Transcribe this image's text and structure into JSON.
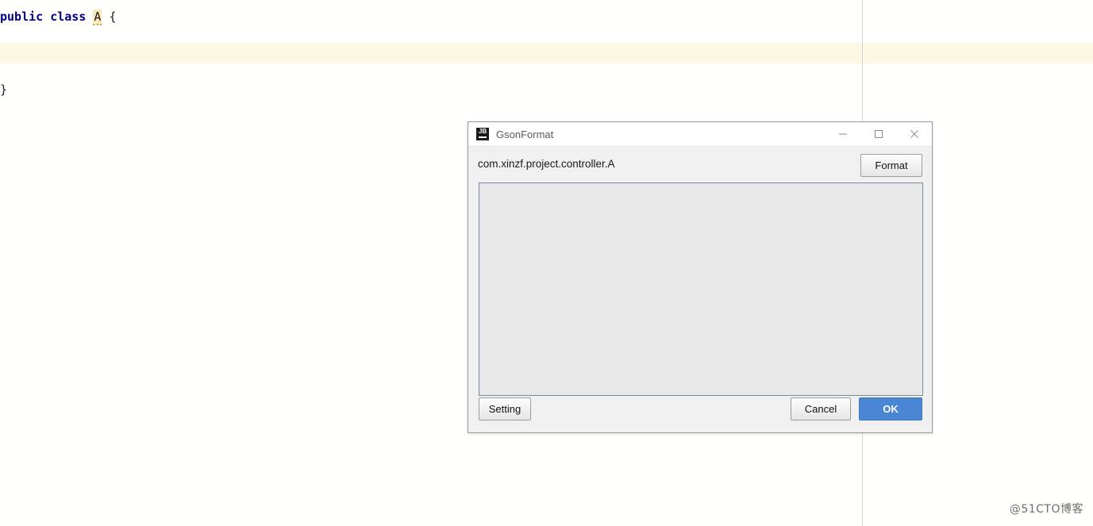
{
  "editor": {
    "lines": [
      {
        "id": "line1",
        "tokens": [
          {
            "text": "public class ",
            "type": "keyword"
          },
          {
            "text": "A",
            "type": "class-name"
          },
          {
            "text": " {",
            "type": "plain"
          }
        ]
      },
      {
        "id": "line3",
        "tokens": [
          {
            "text": "}",
            "type": "plain"
          }
        ]
      }
    ],
    "line1_keyword": "public class",
    "line1_classname": "A",
    "line1_brace": " {",
    "line3_text": "}",
    "highlight_color": "#fdf8e3",
    "keyword_color": "#000080",
    "classname_highlight_color": "#f7e9b8",
    "margin_guide_color": "#d4d4d4"
  },
  "dialog": {
    "title": "GsonFormat",
    "icon": "jetbrains-logo-icon",
    "icon_text": "JB",
    "window_controls": {
      "minimize": "minimize-icon",
      "maximize": "maximize-icon",
      "close": "close-icon"
    },
    "header": {
      "class_path": "com.xinzf.project.controller.A",
      "format_label": "Format"
    },
    "input": {
      "value": "",
      "placeholder": ""
    },
    "footer": {
      "setting_label": "Setting",
      "cancel_label": "Cancel",
      "ok_label": "OK",
      "ok_color": "#4a86d4"
    }
  },
  "watermark": {
    "text": "@51CTO博客"
  }
}
